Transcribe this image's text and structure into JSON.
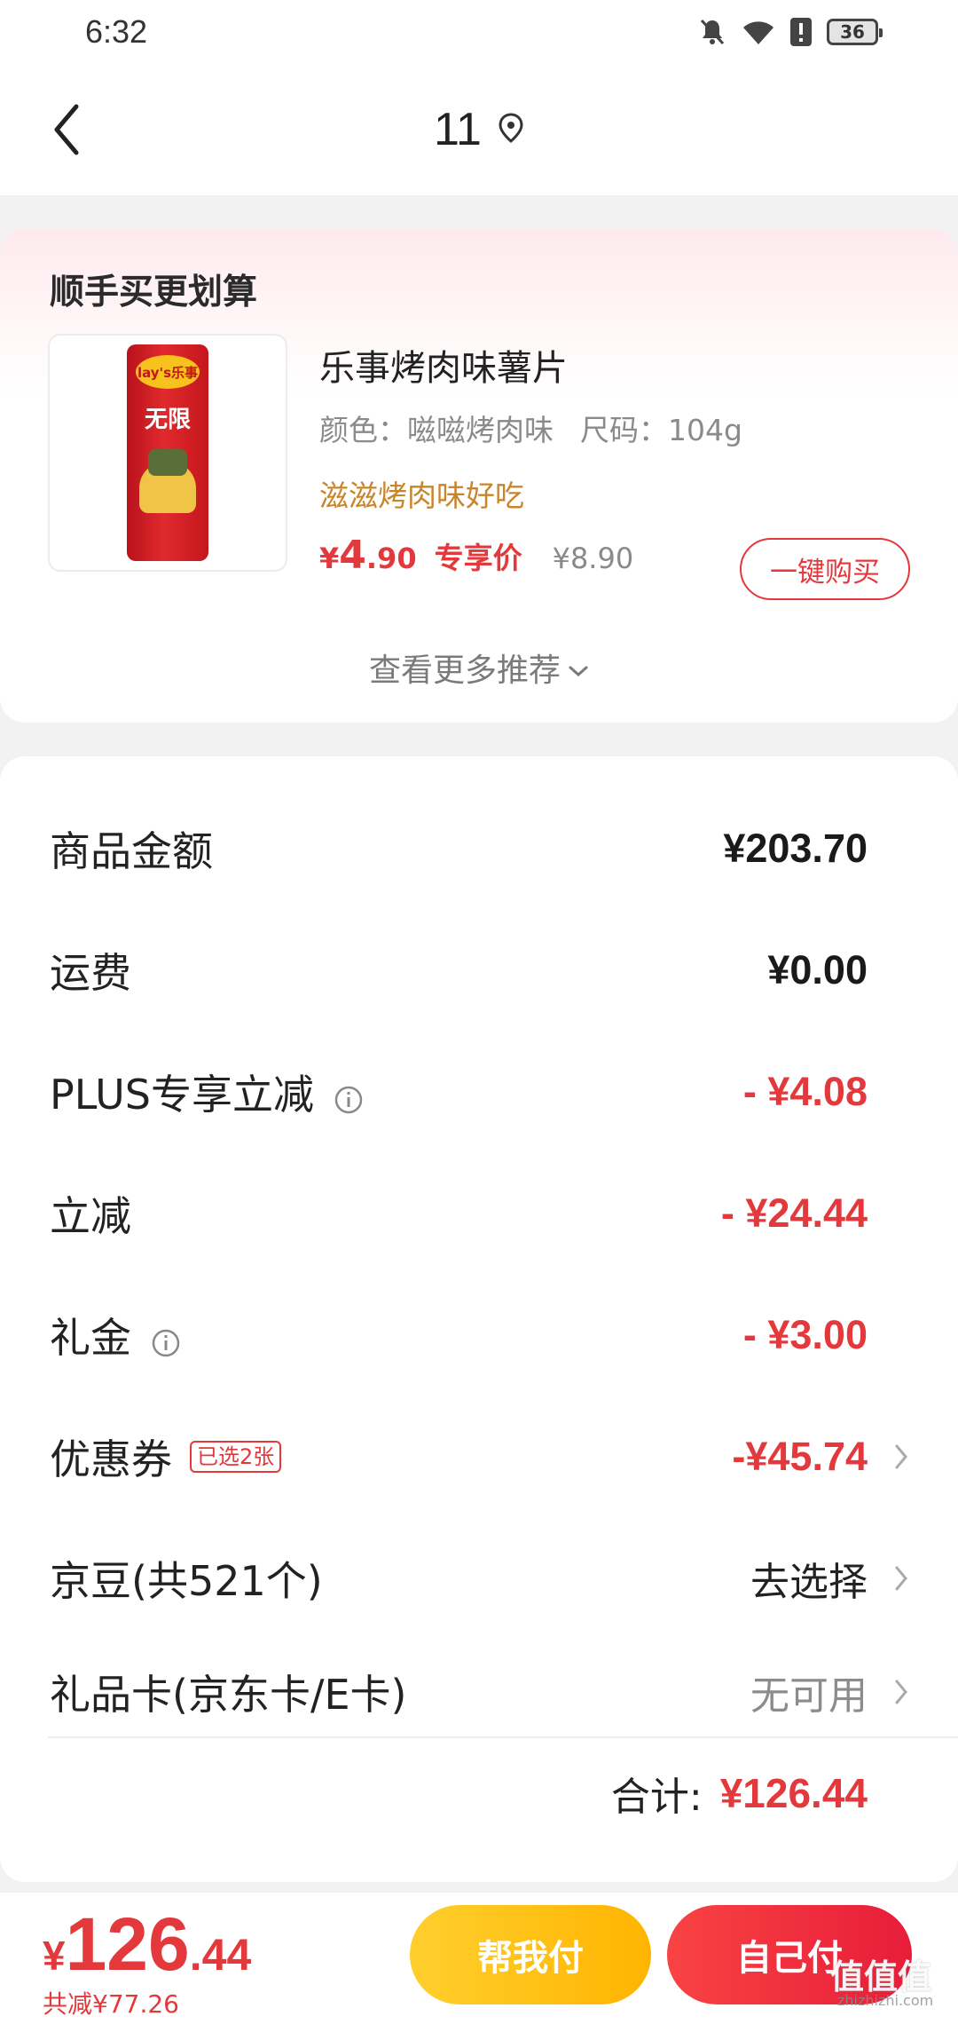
{
  "status_bar": {
    "time": "6:32",
    "battery_level": "36",
    "icons": [
      "bell-muted-icon",
      "wifi-icon",
      "alert-icon",
      "battery-icon"
    ]
  },
  "header": {
    "title": "11",
    "icons": [
      "back-chevron-icon",
      "location-pin-icon"
    ]
  },
  "recommendation": {
    "section_title": "顺手买更划算",
    "product": {
      "name": "乐事烤肉味薯片",
      "spec_color": "颜色：嗞嗞烤肉味",
      "spec_size": "尺码：104g",
      "slogan": "滋滋烤肉味好吃",
      "price_symbol": "¥",
      "price_int": "4",
      "price_dec": ".90",
      "price_tag": "专享价",
      "original_price": "¥8.90",
      "buy_button": "一键购买",
      "image_brand": "lay's乐事",
      "image_name": "无限"
    },
    "more_label": "查看更多推荐",
    "accent_color": "#e4393c"
  },
  "price_breakdown": {
    "rows": [
      {
        "label": "商品金额",
        "value": "¥203.70"
      },
      {
        "label": "运费",
        "value": "¥0.00"
      },
      {
        "label": "PLUS专享立减",
        "value": "- ¥4.08"
      },
      {
        "label": "立减",
        "value": "- ¥24.44"
      },
      {
        "label": "礼金",
        "value": "- ¥3.00"
      },
      {
        "label": "优惠券",
        "badge": "已选2张",
        "value": "-¥45.74"
      },
      {
        "label": "京豆(共521个)",
        "value": "去选择"
      },
      {
        "label": "礼品卡(京东卡/E卡)",
        "value": "无可用"
      }
    ],
    "total_label": "合计:",
    "total_value": "¥126.44"
  },
  "footer": {
    "price_symbol": "¥",
    "price_int": "126",
    "price_dec": ".44",
    "saving_text": "共减¥77.26",
    "help_pay_button": "帮我付",
    "self_pay_button": "自己付"
  },
  "watermark": {
    "text": "值值值",
    "site": "zhizhizhi.com"
  },
  "colors": {
    "accent_red": "#e4393c",
    "help_pay_yellow": "#ffbf1a",
    "slogan_orange": "#c9852a"
  }
}
